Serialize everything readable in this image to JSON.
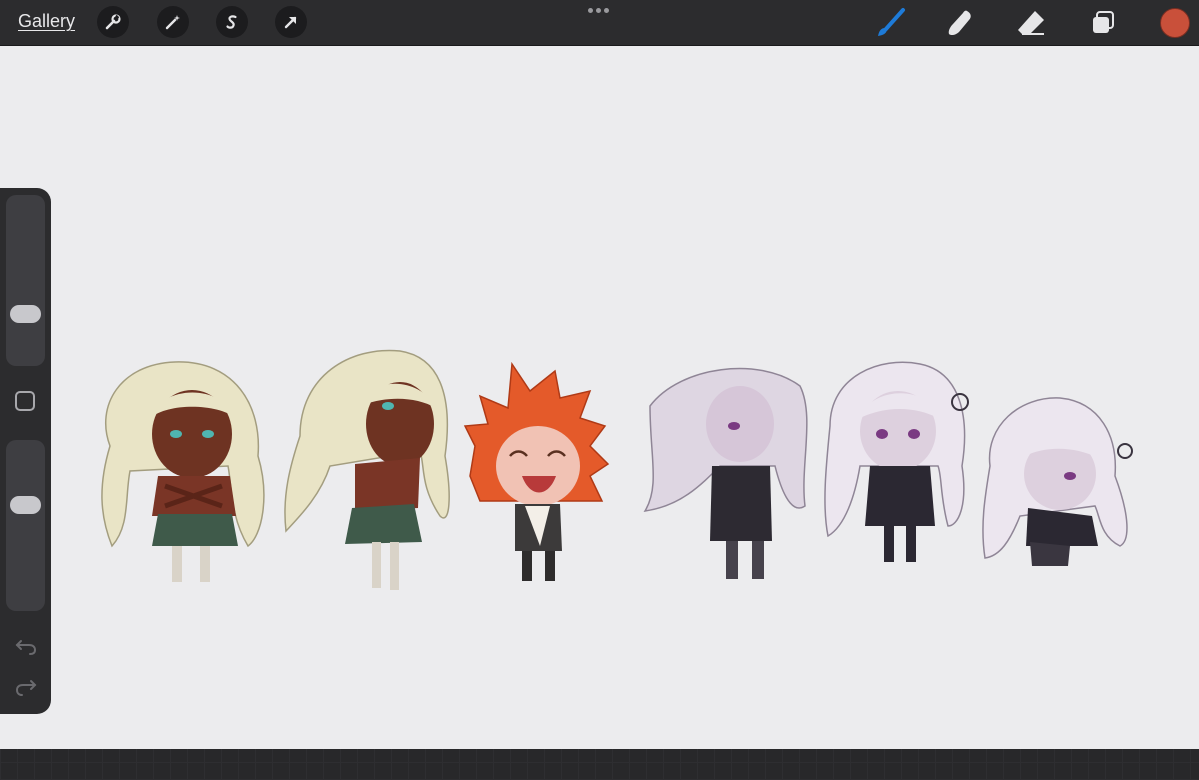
{
  "toolbar": {
    "gallery_label": "Gallery",
    "actions_icon": "wrench-icon",
    "adjustments_icon": "magic-wand-icon",
    "selection_icon": "selection-s-icon",
    "transform_icon": "arrow-icon",
    "brush_icon": "brush-icon",
    "smudge_icon": "smudge-icon",
    "eraser_icon": "eraser-icon",
    "layers_icon": "layers-icon",
    "active_color": "#c9503a",
    "brush_color": "#1e7bd8"
  },
  "sidebar": {
    "brush_size_level": 0.27,
    "opacity_level": 0.64,
    "undo_icon": "undo-icon",
    "redo_icon": "redo-icon"
  }
}
